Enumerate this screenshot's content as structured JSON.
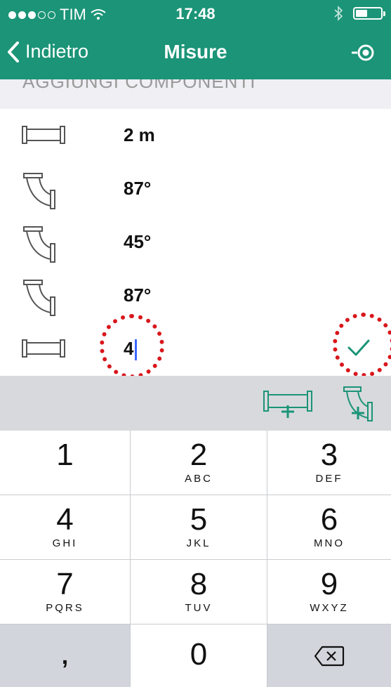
{
  "status_bar": {
    "carrier": "TIM",
    "time": "17:48"
  },
  "nav": {
    "back_label": "Indietro",
    "title": "Misure"
  },
  "section_header": "AGGIUNGI COMPONENTI",
  "components": [
    {
      "icon": "straight-pipe-icon",
      "value": "2 m"
    },
    {
      "icon": "elbow-pipe-icon",
      "value": "87°"
    },
    {
      "icon": "elbow-pipe-icon",
      "value": "45°"
    },
    {
      "icon": "elbow-pipe-icon",
      "value": "87°"
    },
    {
      "icon": "straight-pipe-icon",
      "value": "4"
    }
  ],
  "toolbar": {
    "add_straight_icon": "add-straight-pipe-icon",
    "add_elbow_icon": "add-elbow-pipe-icon"
  },
  "keypad": [
    {
      "digit": "1",
      "letters": ""
    },
    {
      "digit": "2",
      "letters": "ABC"
    },
    {
      "digit": "3",
      "letters": "DEF"
    },
    {
      "digit": "4",
      "letters": "GHI"
    },
    {
      "digit": "5",
      "letters": "JKL"
    },
    {
      "digit": "6",
      "letters": "MNO"
    },
    {
      "digit": "7",
      "letters": "PQRS"
    },
    {
      "digit": "8",
      "letters": "TUV"
    },
    {
      "digit": "9",
      "letters": "WXYZ"
    },
    {
      "digit": ",",
      "letters": ""
    },
    {
      "digit": "0",
      "letters": ""
    }
  ],
  "colors": {
    "brand": "#1b9477",
    "annotation": "#d8171c"
  }
}
